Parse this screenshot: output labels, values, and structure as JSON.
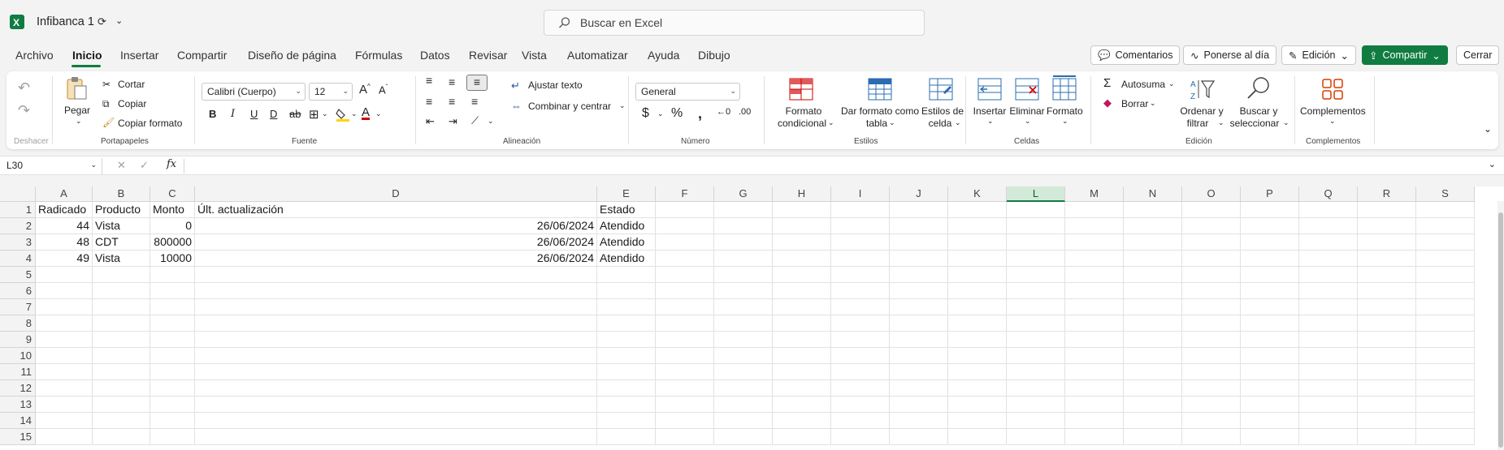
{
  "app": {
    "document_title": "Infibanca 1",
    "brand_color": "#107c41"
  },
  "search": {
    "placeholder": "Buscar en Excel"
  },
  "menu": {
    "tabs": [
      "Archivo",
      "Inicio",
      "Insertar",
      "Compartir",
      "Diseño de página",
      "Fórmulas",
      "Datos",
      "Revisar",
      "Vista",
      "Automatizar",
      "Ayuda",
      "Dibujo"
    ],
    "active_tab": "Inicio"
  },
  "actions": {
    "comments": "Comentarios",
    "catch_up": "Ponerse al día",
    "editing": "Edición",
    "share": "Compartir",
    "close": "Cerrar"
  },
  "ribbon": {
    "undo_group": {
      "label": "Deshacer"
    },
    "clipboard": {
      "label": "Portapapeles",
      "paste": "Pegar",
      "cut": "Cortar",
      "copy": "Copiar",
      "format_painter": "Copiar formato"
    },
    "font": {
      "label": "Fuente",
      "font_name": "Calibri (Cuerpo)",
      "font_size": "12"
    },
    "alignment": {
      "label": "Alineación",
      "wrap": "Ajustar texto",
      "merge": "Combinar y centrar"
    },
    "number": {
      "label": "Número",
      "format": "General"
    },
    "styles": {
      "label": "Estilos",
      "conditional": [
        "Formato",
        "condicional"
      ],
      "as_table": [
        "Dar formato como",
        "tabla"
      ],
      "cell_styles": [
        "Estilos de",
        "celda"
      ]
    },
    "cells": {
      "label": "Celdas",
      "insert": "Insertar",
      "delete": "Eliminar",
      "format": "Formato"
    },
    "editing": {
      "label": "Edición",
      "autosum": "Autosuma",
      "clear": "Borrar",
      "sort": [
        "Ordenar y",
        "filtrar"
      ],
      "find": [
        "Buscar y",
        "seleccionar"
      ]
    },
    "addins": {
      "label": "Complementos",
      "button": "Complementos"
    }
  },
  "formula_bar": {
    "name_box": "L30",
    "fx": "fx"
  },
  "sheet": {
    "columns": [
      "A",
      "B",
      "C",
      "D",
      "E",
      "F",
      "G",
      "H",
      "I",
      "J",
      "K",
      "L",
      "M",
      "N",
      "O",
      "P",
      "Q",
      "R",
      "S"
    ],
    "selected_column": "L",
    "rows": [
      "1",
      "2",
      "3",
      "4",
      "5",
      "6",
      "7",
      "8",
      "9",
      "10",
      "11",
      "12",
      "13",
      "14",
      "15"
    ],
    "header_row": [
      "Radicado",
      "Producto",
      "Monto",
      "Últ. actualización",
      "Estado"
    ],
    "data_rows": [
      [
        "44",
        "Vista",
        "0",
        "26/06/2024",
        "Atendido"
      ],
      [
        "48",
        "CDT",
        "800000",
        "26/06/2024",
        "Atendido"
      ],
      [
        "49",
        "Vista",
        "10000",
        "26/06/2024",
        "Atendido"
      ]
    ]
  }
}
